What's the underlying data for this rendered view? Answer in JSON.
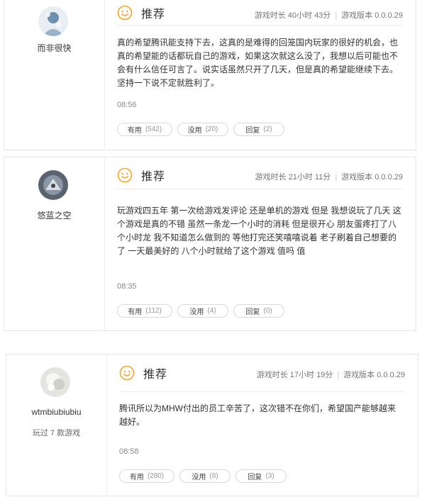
{
  "reviews": [
    {
      "username": "而非很快",
      "played": "",
      "recommend": "推荐",
      "playtime": "游戏时长 40小时 43分",
      "version": "游戏版本 0.0.0.29",
      "text": "真的希望腾讯能支持下去，这真的是难得的回笼国内玩家的很好的机会，也真的希望能的话都玩自己的游戏，如果这次就这么没了，我想以后可能也不会有什么信任可言了。说实话虽然只开了几天，但是真的希望能继续下去。坚持一下说不定就胜利了。",
      "time": "08:56",
      "useful_label": "有用",
      "useful_count": "(542)",
      "useless_label": "没用",
      "useless_count": "(20)",
      "reply_label": "回复",
      "reply_count": "(2)"
    },
    {
      "username": "悠蓝之空",
      "played": "",
      "recommend": "推荐",
      "playtime": "游戏时长 21小时 11分",
      "version": "游戏版本 0.0.0.29",
      "text": "玩游戏四五年 第一次给游戏发评论 还是单机的游戏 但是 我想说玩了几天 这个游戏是真的不错 虽然一条龙一个小时的消耗 但是很开心 朋友蛋疼打了八个小时龙 我不知道怎么做到的 等他打完还笑嘻嘻说着 老子刷着自己想要的了 一天最美好的 八个小时就给了这个游戏 值吗 值",
      "time": "08:35",
      "useful_label": "有用",
      "useful_count": "(112)",
      "useless_label": "没用",
      "useless_count": "(4)",
      "reply_label": "回复",
      "reply_count": "(0)"
    },
    {
      "username": "wtmbiubiubiu",
      "played": "玩过 7 款游戏",
      "recommend": "推荐",
      "playtime": "游戏时长 17小时 19分",
      "version": "游戏版本 0.0.0.29",
      "text": "腾讯所以为MHW付出的员工辛苦了，这次错不在你们，希望国产能够越来越好。",
      "time": "08:58",
      "useful_label": "有用",
      "useful_count": "(280)",
      "useless_label": "没用",
      "useless_count": "(8)",
      "reply_label": "回复",
      "reply_count": "(3)"
    }
  ],
  "icons": {
    "recommend": "smile-face-icon"
  },
  "colors": {
    "accent": "#f5a623",
    "border": "#e6e6e6",
    "meta": "#777777"
  }
}
